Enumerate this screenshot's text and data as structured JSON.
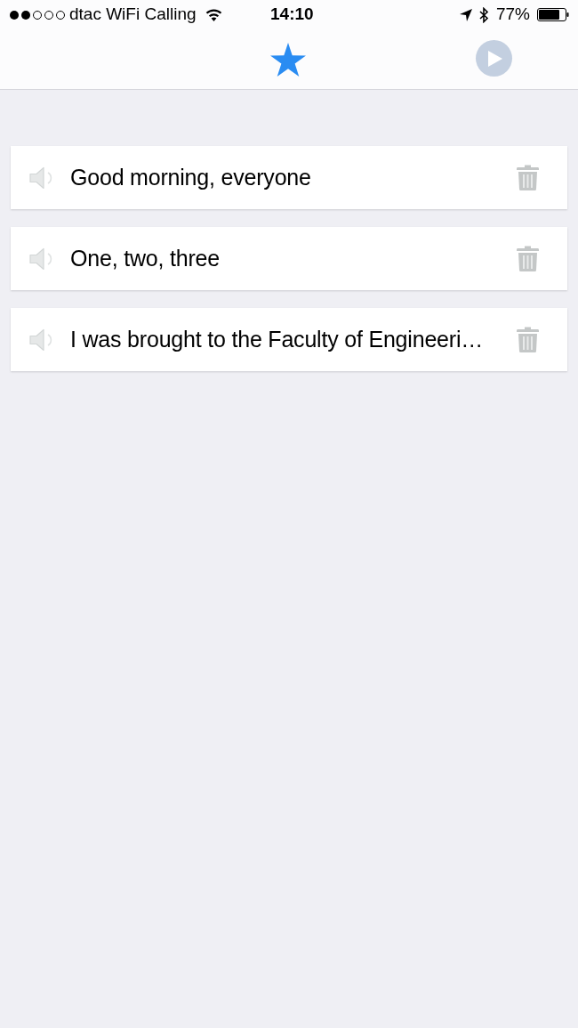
{
  "status_bar": {
    "carrier": "dtac WiFi Calling",
    "time": "14:10",
    "battery": "77%"
  },
  "nav_bar": {
    "play_button": {
      "disabled": true
    }
  },
  "phrases": [
    {
      "text": "Good morning, everyone"
    },
    {
      "text": "One, two, three"
    },
    {
      "text": "I was brought to the Faculty of Engineeri…"
    }
  ]
}
